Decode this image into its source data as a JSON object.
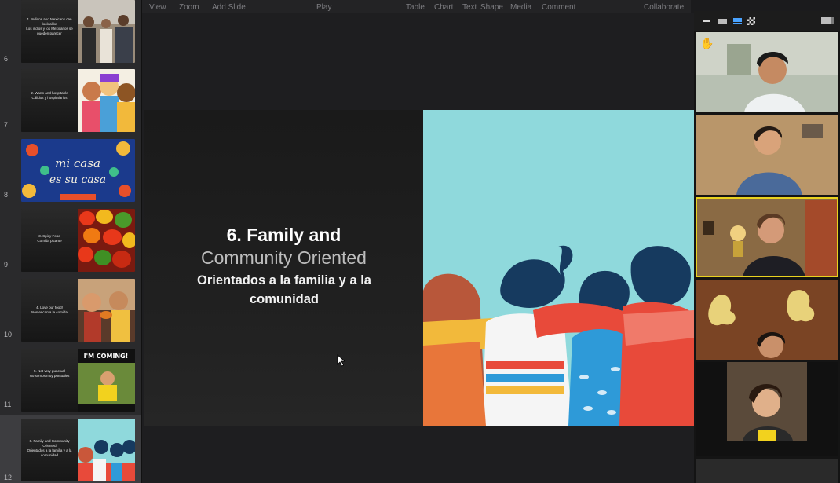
{
  "menubar": {
    "items": [
      "View",
      "Zoom",
      "Add Slide",
      "Play",
      "Table",
      "Chart",
      "Text",
      "Shape",
      "Media",
      "Comment",
      "Collaborate"
    ]
  },
  "sidebar": {
    "slides": [
      {
        "number": "6",
        "text": "1. Indians and Mexicans can look alike\nLos indios y los Mexicanos se pueden parecer",
        "art": "photo-men"
      },
      {
        "number": "7",
        "text": "2. Warm and hospitable\nCálidos y hospitalarios",
        "art": "cartoon-people"
      },
      {
        "number": "8",
        "text": "",
        "art": "mi-casa-es-su-casa",
        "art_text": [
          "mi casa",
          "es su casa"
        ]
      },
      {
        "number": "9",
        "text": "3. Spicy Food\nComida picante",
        "art": "peppers"
      },
      {
        "number": "10",
        "text": "4. Love our food!\nNos encanta la comida",
        "art": "people-eating"
      },
      {
        "number": "11",
        "text": "5. Not very punctual\nNo somos muy puntuales",
        "art": "im-coming",
        "art_text": [
          "I'M COMING!"
        ]
      },
      {
        "number": "12",
        "text": "6. Family and Community Oriented\nOrientados a la familia y a la comunidad",
        "art": "family-hug",
        "selected": true
      }
    ]
  },
  "slide": {
    "title": "6. Family and",
    "subtitle": "Community Oriented",
    "body_line1": "Orientados a la familia y a la",
    "body_line2": "comunidad"
  },
  "video_panel": {
    "participants": [
      {
        "name": "participant-1",
        "raised_hand": true
      },
      {
        "name": "participant-2"
      },
      {
        "name": "participant-3",
        "active_speaker": true
      },
      {
        "name": "participant-4"
      },
      {
        "name": "participant-5"
      }
    ]
  },
  "colors": {
    "accent_active_speaker": "#e9d21f",
    "slide_teal": "#8fd9dc",
    "sidebar_bg": "#2a2a2c"
  }
}
